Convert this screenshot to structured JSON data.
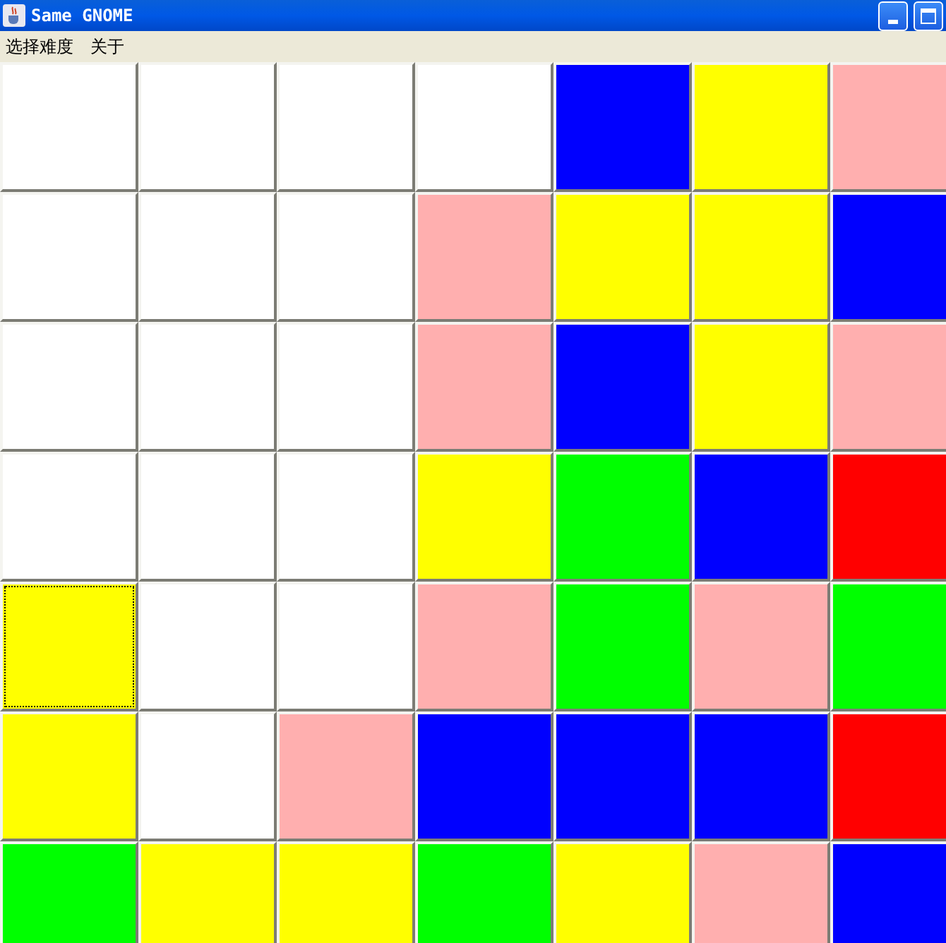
{
  "window": {
    "title": "Same GNOME"
  },
  "menu": [
    "选择难度",
    "关于"
  ],
  "grid": [
    [
      {
        "color": "#ffffff",
        "focused": false
      },
      {
        "color": "#ffffff",
        "focused": false
      },
      {
        "color": "#ffffff",
        "focused": false
      },
      {
        "color": "#ffffff",
        "focused": false
      },
      {
        "color": "#0000ff",
        "focused": false
      },
      {
        "color": "#ffff00",
        "focused": false
      },
      {
        "color": "#ffafaf",
        "focused": false
      }
    ],
    [
      {
        "color": "#ffffff",
        "focused": false
      },
      {
        "color": "#ffffff",
        "focused": false
      },
      {
        "color": "#ffffff",
        "focused": false
      },
      {
        "color": "#ffafaf",
        "focused": false
      },
      {
        "color": "#ffff00",
        "focused": false
      },
      {
        "color": "#ffff00",
        "focused": false
      },
      {
        "color": "#0000ff",
        "focused": false
      }
    ],
    [
      {
        "color": "#ffffff",
        "focused": false
      },
      {
        "color": "#ffffff",
        "focused": false
      },
      {
        "color": "#ffffff",
        "focused": false
      },
      {
        "color": "#ffafaf",
        "focused": false
      },
      {
        "color": "#0000ff",
        "focused": false
      },
      {
        "color": "#ffff00",
        "focused": false
      },
      {
        "color": "#ffafaf",
        "focused": false
      }
    ],
    [
      {
        "color": "#ffffff",
        "focused": false
      },
      {
        "color": "#ffffff",
        "focused": false
      },
      {
        "color": "#ffffff",
        "focused": false
      },
      {
        "color": "#ffff00",
        "focused": false
      },
      {
        "color": "#00ff00",
        "focused": false
      },
      {
        "color": "#0000ff",
        "focused": false
      },
      {
        "color": "#ff0000",
        "focused": false
      }
    ],
    [
      {
        "color": "#ffff00",
        "focused": true
      },
      {
        "color": "#ffffff",
        "focused": false
      },
      {
        "color": "#ffffff",
        "focused": false
      },
      {
        "color": "#ffafaf",
        "focused": false
      },
      {
        "color": "#00ff00",
        "focused": false
      },
      {
        "color": "#ffafaf",
        "focused": false
      },
      {
        "color": "#00ff00",
        "focused": false
      }
    ],
    [
      {
        "color": "#ffff00",
        "focused": false
      },
      {
        "color": "#ffffff",
        "focused": false
      },
      {
        "color": "#ffafaf",
        "focused": false
      },
      {
        "color": "#0000ff",
        "focused": false
      },
      {
        "color": "#0000ff",
        "focused": false
      },
      {
        "color": "#0000ff",
        "focused": false
      },
      {
        "color": "#ff0000",
        "focused": false
      }
    ],
    [
      {
        "color": "#00ff00",
        "focused": false
      },
      {
        "color": "#ffff00",
        "focused": false
      },
      {
        "color": "#ffff00",
        "focused": false
      },
      {
        "color": "#00ff00",
        "focused": false
      },
      {
        "color": "#ffff00",
        "focused": false
      },
      {
        "color": "#ffafaf",
        "focused": false
      },
      {
        "color": "#0000ff",
        "focused": false
      }
    ]
  ]
}
